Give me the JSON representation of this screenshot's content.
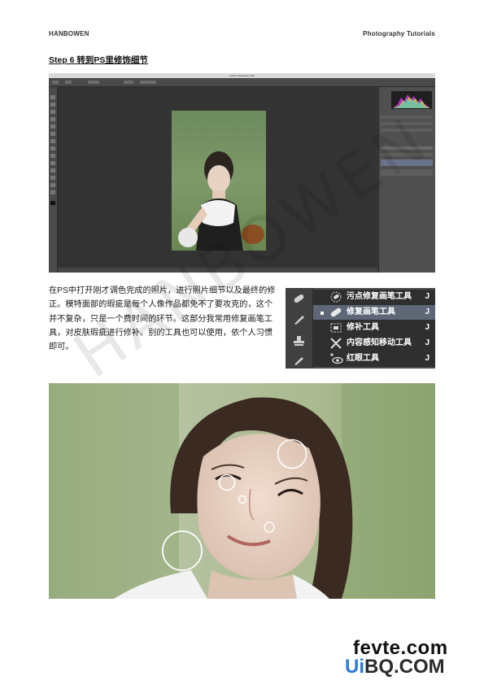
{
  "header": {
    "left": "HANBOWEN",
    "right": "Photography Tutorials"
  },
  "step_title": "Step 6 转到PS里修饰细节",
  "photoshop_screenshot": {
    "window_title": "Adobe Photoshop CS6"
  },
  "paragraph": "在PS中打开刚才调色完成的照片，进行照片细节以及最终的修正。模特面部的瑕疵是每个人像作品都免不了要攻克的，这个并不复杂，只是一个费时间的环节。这部分我常用修复画笔工具，对皮肤瑕疵进行修补。别的工具也可以使用，依个人习惯即可。",
  "tool_menu": {
    "items": [
      {
        "label": "污点修复画笔工具",
        "shortcut": "J",
        "icon": "spot-healing-brush-icon",
        "selected": false
      },
      {
        "label": "修复画笔工具",
        "shortcut": "J",
        "icon": "healing-brush-icon",
        "selected": true
      },
      {
        "label": "修补工具",
        "shortcut": "J",
        "icon": "patch-tool-icon",
        "selected": false
      },
      {
        "label": "内容感知移动工具",
        "shortcut": "J",
        "icon": "content-aware-move-icon",
        "selected": false
      },
      {
        "label": "红眼工具",
        "shortcut": "J",
        "icon": "red-eye-icon",
        "selected": false
      }
    ]
  },
  "watermark": "HANBOWEN",
  "logo": {
    "top": "fevte.com",
    "bottom_ui": "Ui",
    "bottom_rest": "BQ.COM"
  },
  "colors": {
    "ps_background": "#3c3c3c",
    "menu_selected": "#5d6776",
    "logo_blue": "#2c7bd6"
  }
}
